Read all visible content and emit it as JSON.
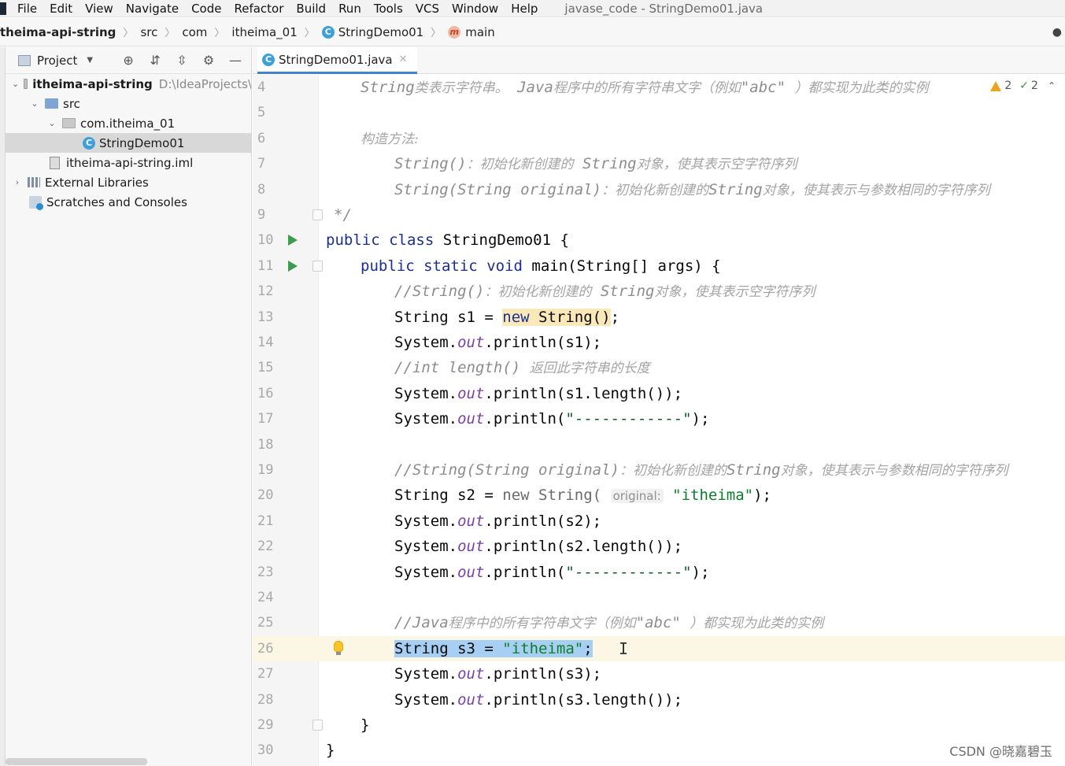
{
  "menu": {
    "items": [
      "File",
      "Edit",
      "View",
      "Navigate",
      "Code",
      "Refactor",
      "Build",
      "Run",
      "Tools",
      "VCS",
      "Window",
      "Help"
    ],
    "window_title": "javase_code - StringDemo01.java"
  },
  "breadcrumb": {
    "project": "theima-api-string",
    "items": [
      "src",
      "com",
      "itheima_01",
      "StringDemo01",
      "main"
    ]
  },
  "project_panel": {
    "title": "Project",
    "tree": [
      {
        "label": "itheima-api-string",
        "extra": "D:\\IdeaProjects\\"
      },
      {
        "label": "src"
      },
      {
        "label": "com.itheima_01"
      },
      {
        "label": "StringDemo01"
      },
      {
        "label": "itheima-api-string.iml"
      },
      {
        "label": "External Libraries"
      },
      {
        "label": "Scratches and Consoles"
      }
    ]
  },
  "editor": {
    "tab_label": "StringDemo01.java",
    "inspections": {
      "warnings": "2",
      "weak_warnings": "2"
    },
    "line_numbers": [
      "4",
      "5",
      "6",
      "7",
      "8",
      "9",
      "10",
      "11",
      "12",
      "13",
      "14",
      "15",
      "16",
      "17",
      "18",
      "19",
      "20",
      "21",
      "22",
      "23",
      "24",
      "25",
      "26",
      "27",
      "28",
      "29",
      "30"
    ],
    "code": {
      "l4_a": "String",
      "l4_b": "类表示字符串。",
      "l4_c": "Java",
      "l4_d": "程序中的所有字符串文字（例如",
      "l4_e": "\"abc\"",
      "l4_f": "）都实现为此类的实例",
      "l6": "构造方法:",
      "l7_a": "String()",
      "l7_b": "：初始化新创建的",
      "l7_c": "String",
      "l7_d": "对象，使其表示空字符序列",
      "l8_a": "String(String original)",
      "l8_b": "：初始化新创建的",
      "l8_c": "String",
      "l8_d": "对象，使其表示与参数相同的字符序列",
      "l9": "*/",
      "public": "public",
      "class": "class",
      "class_name": "StringDemo01 {",
      "static": "static",
      "void": "void",
      "main_sig": "main(String[] args) {",
      "l12_a": "//String()",
      "l12_b": "：初始化新创建的",
      "l12_c": "String",
      "l12_d": "对象，使其表示空字符序列",
      "l13_a": "String s1 = ",
      "new": "new",
      "l13_b": " String()",
      "semi": ";",
      "sys": "System.",
      "out": "out",
      "l14": ".println(s1);",
      "l15_a": "//int length()",
      "l15_b": "返回此字符串的长度",
      "l16": ".println(s1.length());",
      "l17_a": ".println(",
      "dashes": "\"------------\"",
      "l17_b": ");",
      "l19_a": "//String(String original)",
      "l19_b": "：初始化新创建的",
      "l19_c": "String",
      "l19_d": "对象，使其表示与参数相同的字符序列",
      "l20_a": "String s2 = ",
      "new_plain": "new",
      "l20_b": " String(",
      "param_hint": "original:",
      "itheima": "\"itheima\"",
      "l20_c": ");",
      "l21": ".println(s2);",
      "l22": ".println(s2.length());",
      "l25_a": "//Java",
      "l25_b": "程序中的所有字符串文字（例如",
      "l25_c": "\"abc\"",
      "l25_d": "）都实现为此类的实例",
      "l26_a": "String s3 = ",
      "l26_b": ";",
      "l27": ".println(s3);",
      "l28": ".println(s3.length());",
      "close_brace": "}"
    }
  },
  "watermark": "CSDN @晓嘉碧玉",
  "colors": {
    "keyword": "#1a2e94",
    "string": "#0d7d2b",
    "comment": "#8c8c8c",
    "field": "#7a3fa8",
    "selection": "#a7cff3",
    "tab_accent": "#4083c9"
  }
}
